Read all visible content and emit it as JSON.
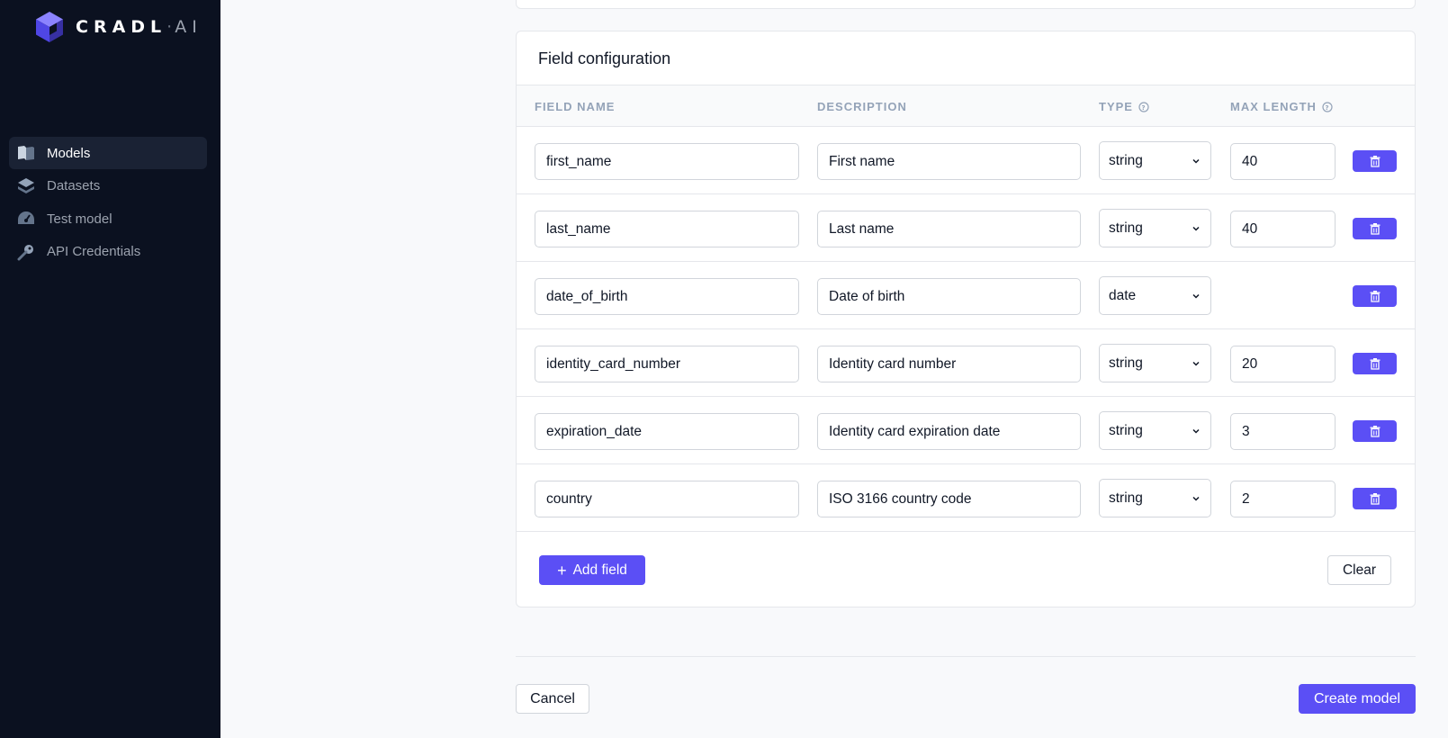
{
  "brand": {
    "name": "CRADL",
    "separator": "·",
    "suffix": "AI",
    "logo_icon": "cube-logo-icon",
    "accent": "#5b4ff5"
  },
  "sidebar": {
    "items": [
      {
        "label": "Models",
        "icon": "book-icon",
        "active": true
      },
      {
        "label": "Datasets",
        "icon": "layers-icon",
        "active": false
      },
      {
        "label": "Test model",
        "icon": "gauge-icon",
        "active": false
      },
      {
        "label": "API Credentials",
        "icon": "key-icon",
        "active": false
      }
    ]
  },
  "field_config": {
    "title": "Field configuration",
    "columns": {
      "field_name": "FIELD NAME",
      "description": "DESCRIPTION",
      "type": "TYPE",
      "max_length": "MAX LENGTH"
    },
    "rows": [
      {
        "field_name": "first_name",
        "description": "First name",
        "type": "string",
        "max_length": "40"
      },
      {
        "field_name": "last_name",
        "description": "Last name",
        "type": "string",
        "max_length": "40"
      },
      {
        "field_name": "date_of_birth",
        "description": "Date of birth",
        "type": "date",
        "max_length": ""
      },
      {
        "field_name": "identity_card_number",
        "description": "Identity card number",
        "type": "string",
        "max_length": "20"
      },
      {
        "field_name": "expiration_date",
        "description": "Identity card expiration date",
        "type": "string",
        "max_length": "3"
      },
      {
        "field_name": "country",
        "description": "ISO 3166 country code",
        "type": "string",
        "max_length": "2"
      }
    ],
    "add_field_label": "Add field",
    "clear_label": "Clear"
  },
  "footer": {
    "cancel_label": "Cancel",
    "create_label": "Create model"
  }
}
